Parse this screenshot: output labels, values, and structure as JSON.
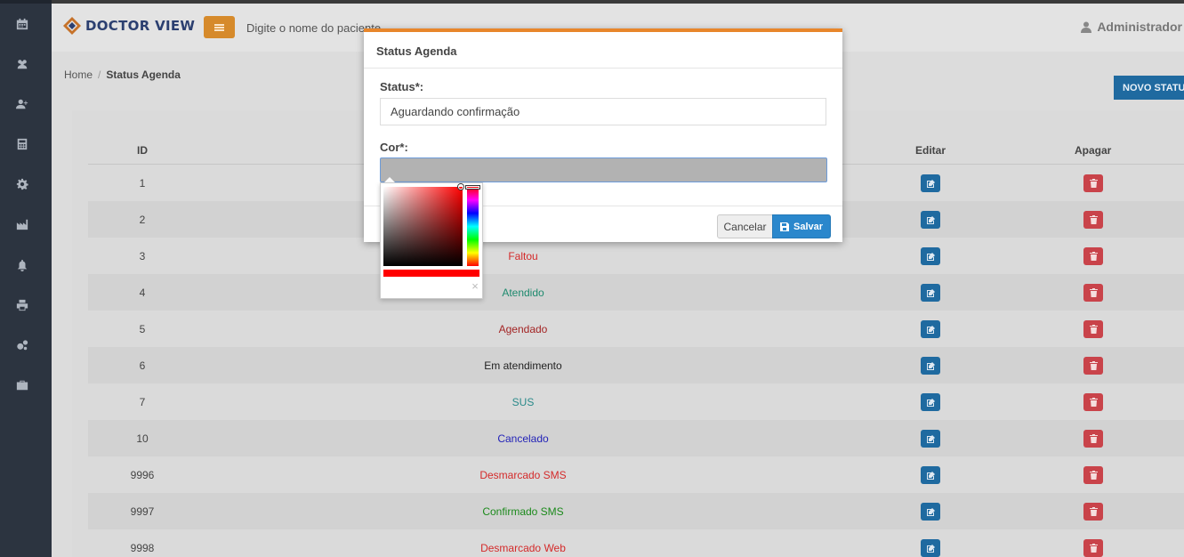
{
  "sidebar": {
    "items": [
      {
        "icon": "calendar-icon"
      },
      {
        "icon": "users-icon"
      },
      {
        "icon": "user-plus-icon"
      },
      {
        "icon": "calculator-icon"
      },
      {
        "icon": "gear-icon"
      },
      {
        "icon": "industry-icon"
      },
      {
        "icon": "bell-icon"
      },
      {
        "icon": "print-icon"
      },
      {
        "icon": "gears-icon"
      },
      {
        "icon": "briefcase-icon"
      }
    ]
  },
  "header": {
    "logo_text": "DOCTOR VIEW",
    "search_placeholder": "Digite o nome do paciente",
    "user_name": "Administrador"
  },
  "breadcrumb": {
    "home": "Home",
    "separator": "/",
    "current": "Status Agenda"
  },
  "actions": {
    "new_status_label": "NOVO STATUS"
  },
  "table": {
    "headers": {
      "id": "ID",
      "edit": "Editar",
      "delete": "Apagar"
    },
    "rows": [
      {
        "id": "1",
        "description": "",
        "color": "#444444"
      },
      {
        "id": "2",
        "description": "",
        "color": "#444444"
      },
      {
        "id": "3",
        "description": "Faltou",
        "color": "#d42a2a"
      },
      {
        "id": "4",
        "description": "Atendido",
        "color": "#1e8a6e"
      },
      {
        "id": "5",
        "description": "Agendado",
        "color": "#a32424"
      },
      {
        "id": "6",
        "description": "Em atendimento",
        "color": "#222222"
      },
      {
        "id": "7",
        "description": "SUS",
        "color": "#2a8a8a"
      },
      {
        "id": "10",
        "description": "Cancelado",
        "color": "#2323b8"
      },
      {
        "id": "9996",
        "description": "Desmarcado SMS",
        "color": "#d42a2a"
      },
      {
        "id": "9997",
        "description": "Confirmado SMS",
        "color": "#1c8a1c"
      },
      {
        "id": "9998",
        "description": "Desmarcado Web",
        "color": "#d42a2a"
      }
    ]
  },
  "modal": {
    "title": "Status Agenda",
    "status_label": "Status*:",
    "status_value": "Aguardando confirmação",
    "color_label": "Cor*:",
    "color_value": "#b2b2b2",
    "cancel_label": "Cancelar",
    "save_label": "Salvar"
  },
  "color_picker": {
    "selected_hue": "#ff0000",
    "close_glyph": "×"
  },
  "colors": {
    "sidebar_bg": "#2c3440",
    "accent_orange": "#e8862b",
    "primary_blue": "#2a87cc",
    "danger_red": "#c9434a"
  }
}
